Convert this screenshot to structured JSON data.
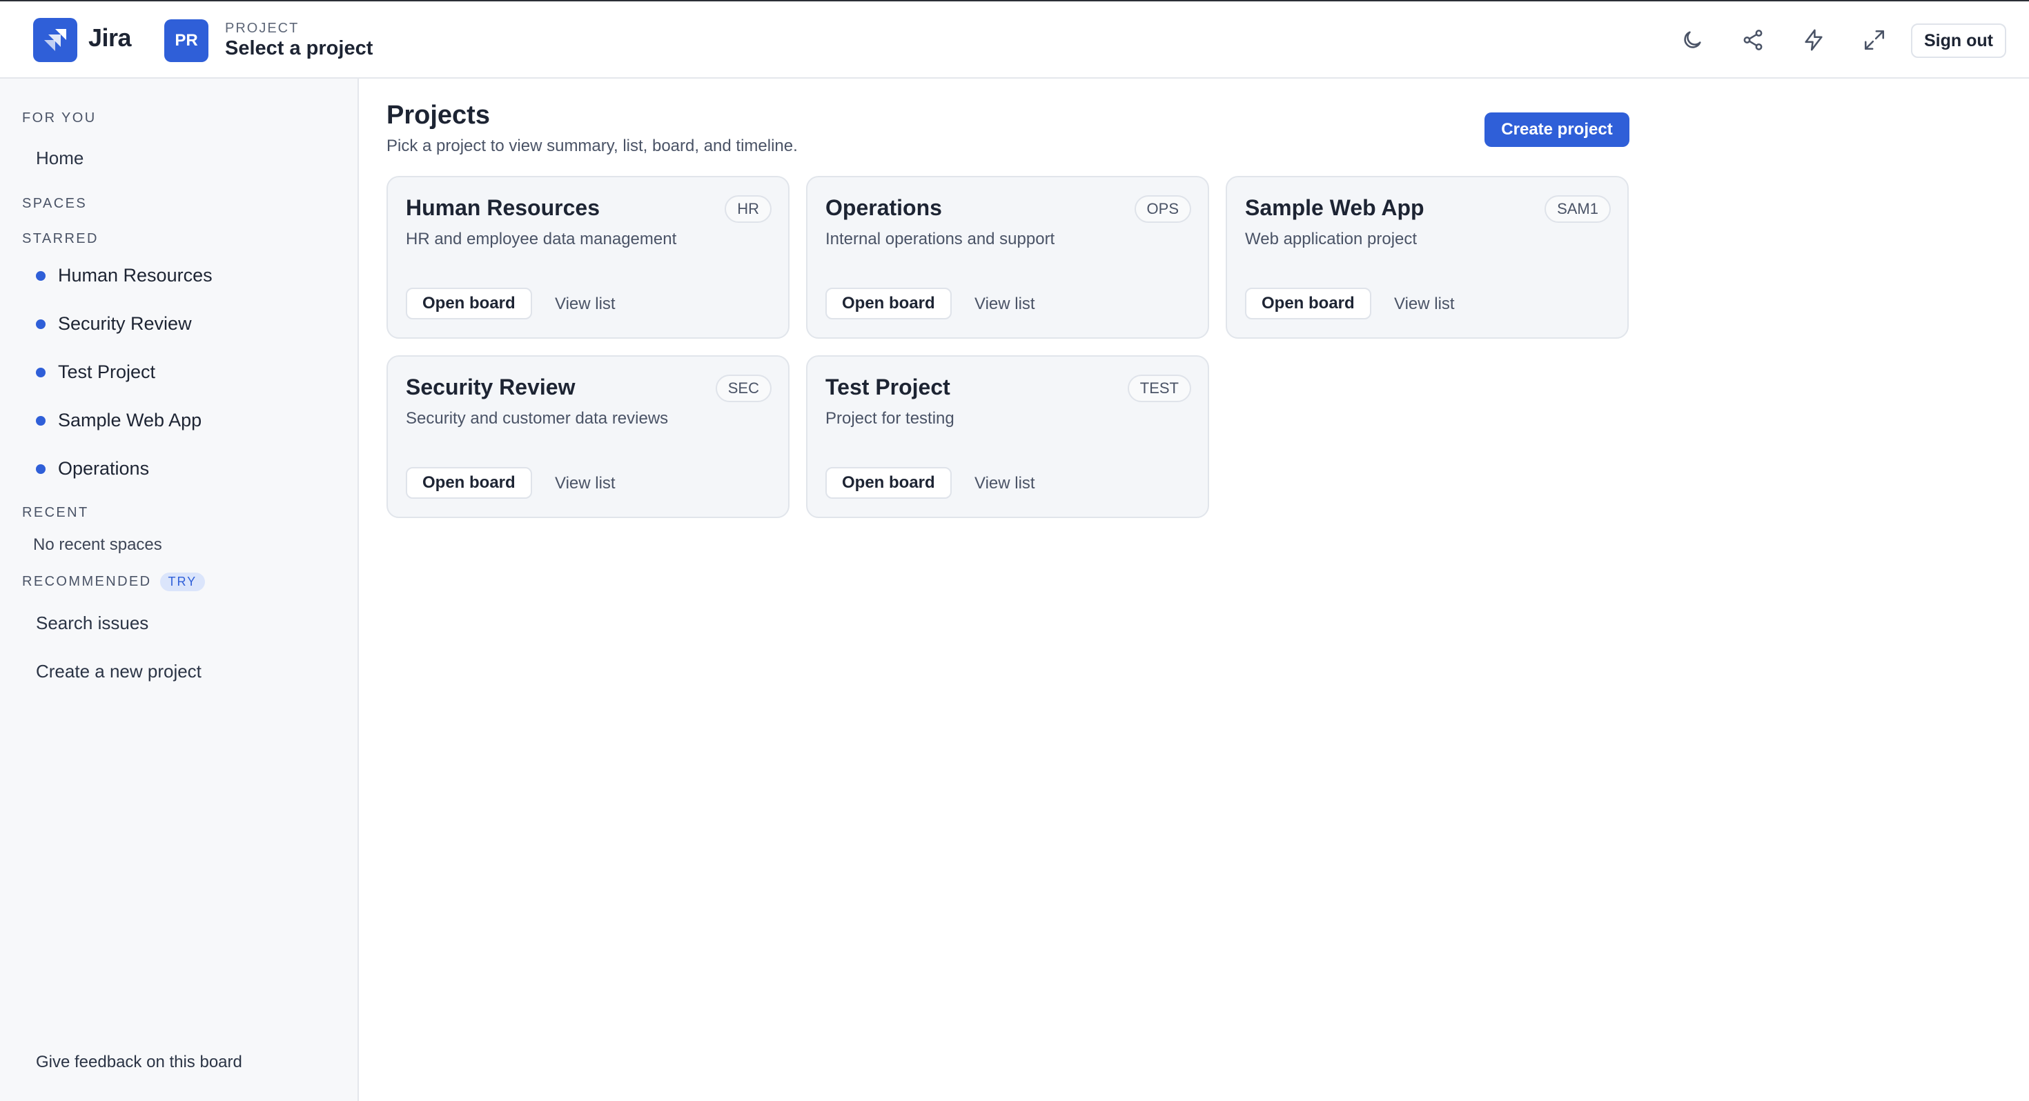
{
  "header": {
    "app_name": "Jira",
    "project_badge": "PR",
    "project_caption": "PROJECT",
    "project_title": "Select a project",
    "sign_out_label": "Sign out",
    "icons": [
      "moon-icon",
      "share-icon",
      "lightning-icon",
      "expand-icon"
    ]
  },
  "sidebar": {
    "for_you_label": "FOR YOU",
    "home_label": "Home",
    "spaces_label": "SPACES",
    "starred_label": "STARRED",
    "starred_items": [
      {
        "label": "Human Resources"
      },
      {
        "label": "Security Review"
      },
      {
        "label": "Test Project"
      },
      {
        "label": "Sample Web App"
      },
      {
        "label": "Operations"
      }
    ],
    "recent_label": "RECENT",
    "recent_empty": "No recent spaces",
    "recommended_label": "RECOMMENDED",
    "recommended_badge": "TRY",
    "recommended_items": [
      {
        "label": "Search issues"
      },
      {
        "label": "Create a new project"
      }
    ],
    "feedback_label": "Give feedback on this board"
  },
  "main": {
    "title": "Projects",
    "subtitle": "Pick a project to view summary, list, board, and timeline.",
    "create_label": "Create project",
    "open_board_label": "Open board",
    "view_list_label": "View list",
    "projects": [
      {
        "name": "Human Resources",
        "key": "HR",
        "description": "HR and employee data management"
      },
      {
        "name": "Operations",
        "key": "OPS",
        "description": "Internal operations and support"
      },
      {
        "name": "Sample Web App",
        "key": "SAM1",
        "description": "Web application project"
      },
      {
        "name": "Security Review",
        "key": "SEC",
        "description": "Security and customer data reviews"
      },
      {
        "name": "Test Project",
        "key": "TEST",
        "description": "Project for testing"
      }
    ]
  },
  "colors": {
    "accent": "#2f5fd8",
    "sidebar_bg": "#f7f8fa",
    "card_bg": "#f4f6f9",
    "text_primary": "#1d2433",
    "text_muted": "#4a5366"
  }
}
